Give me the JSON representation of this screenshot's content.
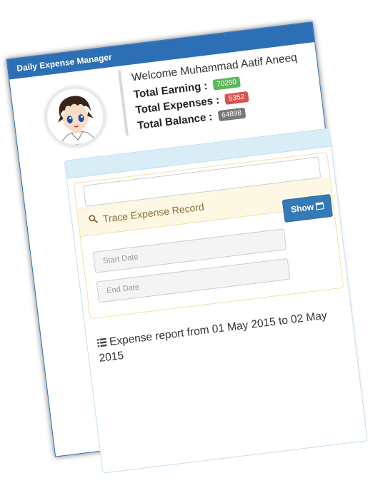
{
  "app": {
    "title": "Daily Expense Manager"
  },
  "profile": {
    "welcome": "Welcome Muhammad Aatif Aneeq",
    "earning_label": "Total Earning :",
    "earning_value": "70250",
    "expenses_label": "Total Expenses :",
    "expenses_value": "5352",
    "balance_label": "Total Balance :",
    "balance_value": "64898"
  },
  "trace": {
    "title": "Trace Expense Record",
    "start_placeholder": "Start Date",
    "end_placeholder": "End Date",
    "show_label": "Show"
  },
  "report": {
    "text": "Expense report from 01 May 2015 to 02 May 2015"
  },
  "colors": {
    "primary": "#2d6fb5",
    "earning_badge": "#5cb85c",
    "expenses_badge": "#d9534f",
    "balance_badge": "#777777"
  },
  "icons": {
    "search": "magnifier-icon",
    "calendar": "calendar-icon",
    "list": "list-icon"
  }
}
